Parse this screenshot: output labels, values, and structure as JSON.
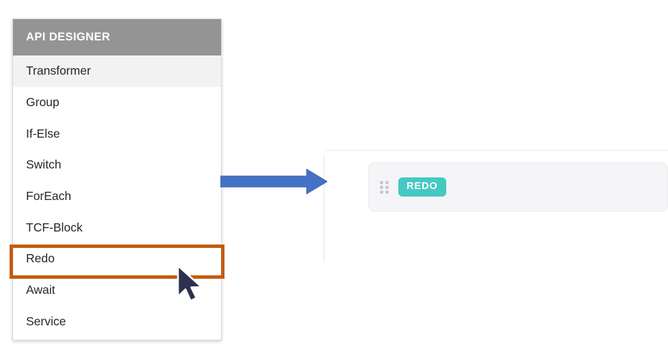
{
  "palette": {
    "header_title": "API DESIGNER",
    "items": [
      {
        "label": "Transformer",
        "active": true
      },
      {
        "label": "Group",
        "active": false
      },
      {
        "label": "If-Else",
        "active": false
      },
      {
        "label": "Switch",
        "active": false
      },
      {
        "label": "ForEach",
        "active": false
      },
      {
        "label": "TCF-Block",
        "active": false
      },
      {
        "label": "Redo",
        "active": false
      },
      {
        "label": "Await",
        "active": false
      },
      {
        "label": "Service",
        "active": false
      }
    ]
  },
  "annotations": {
    "highlight_target": "Redo",
    "highlight_color": "#c25c0f",
    "arrow_color": "#4472c4",
    "cursor_color": "#2e3050"
  },
  "canvas": {
    "node": {
      "badge_label": "REDO",
      "badge_color": "#46c8c2",
      "drag_handle_dots": 6
    }
  }
}
